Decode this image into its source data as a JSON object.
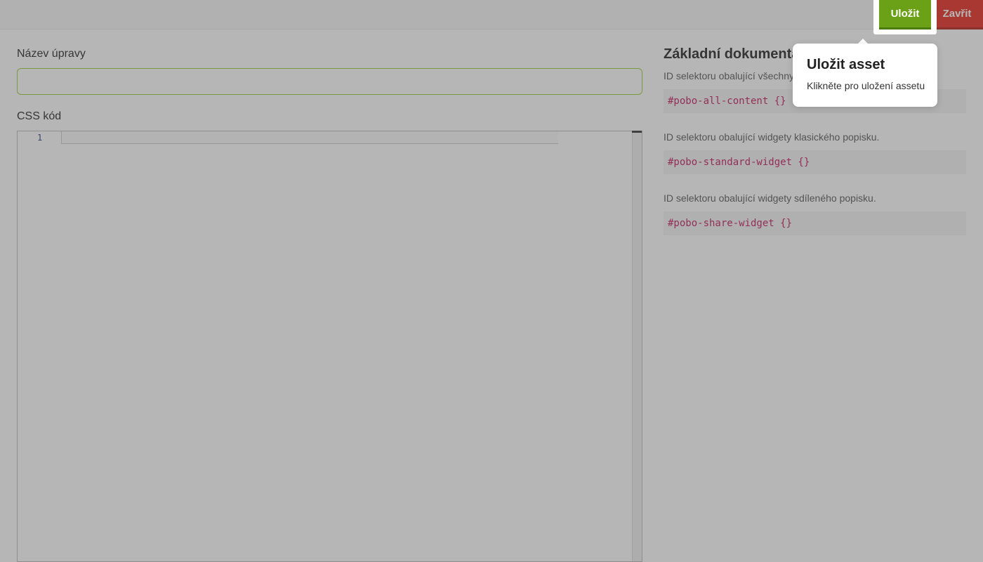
{
  "toolbar": {
    "save_label": "Uložit",
    "close_label": "Zavřit",
    "save_color": "#6aa116",
    "close_color": "#e8261c"
  },
  "form": {
    "name_label": "Název úpravy",
    "name_value": "",
    "css_label": "CSS kód",
    "editor_line_numbers": [
      "1"
    ]
  },
  "docs": {
    "title": "Základní dokumentace",
    "items": [
      {
        "description": "ID selektoru obalující všechny widgety.",
        "code": "#pobo-all-content {}"
      },
      {
        "description": "ID selektoru obalující widgety klasického popisku.",
        "code": "#pobo-standard-widget {}"
      },
      {
        "description": "ID selektoru obalující widgety sdíleného popisku.",
        "code": "#pobo-share-widget {}"
      }
    ]
  },
  "tooltip": {
    "title": "Uložit asset",
    "text": "Klikněte pro uložení assetu"
  }
}
